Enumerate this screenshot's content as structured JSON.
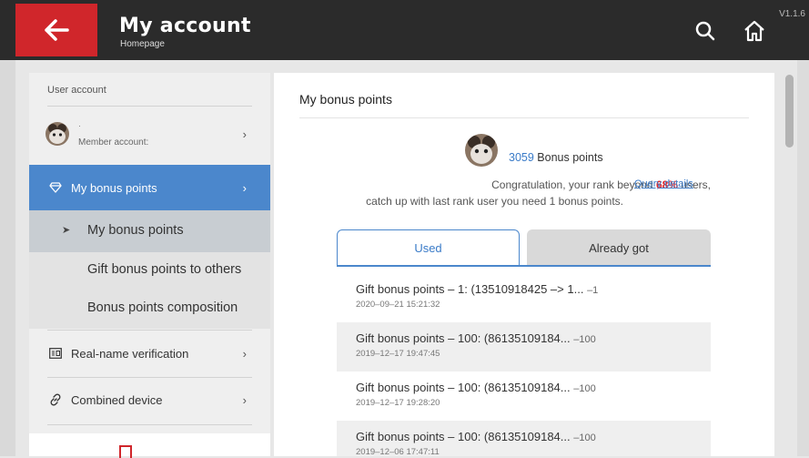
{
  "header": {
    "title": "My account",
    "subtitle": "Homepage",
    "version": "V1.1.6",
    "back_icon": "arrow-left-icon",
    "search_icon": "search-icon",
    "home_icon": "home-icon"
  },
  "sidebar": {
    "section_label": "User account",
    "user_name": "·",
    "member_label": "Member account:",
    "active_item": "My bonus points",
    "sub_items": [
      "My bonus points",
      "Gift bonus points to others",
      "Bonus points composition"
    ],
    "items": [
      "Real-name verification",
      "Combined device"
    ],
    "chevron": "›",
    "sub_arrow": "➤"
  },
  "content": {
    "title": "My bonus points",
    "points_value": "3059",
    "points_label": "Bonus points",
    "congrats_prefix": "Congratulation, your rank beyond",
    "rank_percent": "68%",
    "congrats_suffix": "users,",
    "congrats_line2": "catch up with last rank user you need 1 bonus points.",
    "query_link": "Query details",
    "tabs": [
      "Used",
      "Already got"
    ],
    "records": [
      {
        "desc": "Gift bonus points  –  1: (13510918425 –> 1...",
        "amount": "–1",
        "date": "2020–09–21 15:21:32"
      },
      {
        "desc": "Gift bonus points  –  100: (86135109184...",
        "amount": "–100",
        "date": "2019–12–17 19:47:45"
      },
      {
        "desc": "Gift bonus points  –  100: (86135109184...",
        "amount": "–100",
        "date": "2019–12–17 19:28:20"
      },
      {
        "desc": "Gift bonus points  –  100: (86135109184...",
        "amount": "–100",
        "date": "2019–12–06 17:47:11"
      }
    ]
  },
  "colors": {
    "accent": "#4b87cc",
    "brand_red": "#d0262b",
    "topbar": "#2b2b2b"
  }
}
